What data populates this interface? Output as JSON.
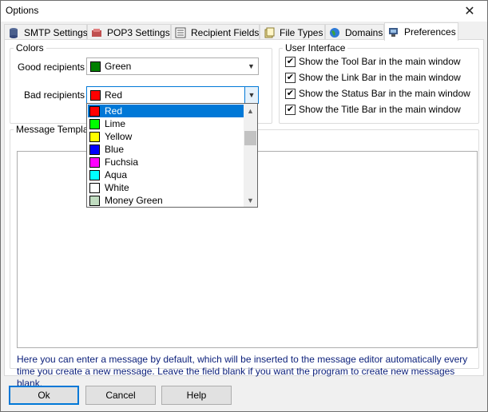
{
  "window": {
    "title": "Options",
    "close_glyph": "✕"
  },
  "tabs": [
    {
      "label": "SMTP Settings",
      "icon": "database-icon"
    },
    {
      "label": "POP3 Settings",
      "icon": "pop3-icon"
    },
    {
      "label": "Recipient Fields",
      "icon": "list-icon"
    },
    {
      "label": "File Types",
      "icon": "file-types-icon"
    },
    {
      "label": "Domains",
      "icon": "globe-icon"
    },
    {
      "label": "Preferences",
      "icon": "preferences-icon",
      "active": true
    }
  ],
  "colors_group": {
    "legend": "Colors",
    "good_label": "Good recipients :",
    "good_value": "Green",
    "good_color": "#008000",
    "bad_label": "Bad recipients :",
    "bad_value": "Red",
    "bad_color": "#ff0000"
  },
  "ui_group": {
    "legend": "User Interface",
    "options": [
      {
        "label": "Show the Tool Bar in the main window",
        "checked": true
      },
      {
        "label": "Show the Link Bar in the main window",
        "checked": true
      },
      {
        "label": "Show the Status Bar in the main window",
        "checked": true
      },
      {
        "label": "Show the Title Bar in the main window",
        "checked": true
      }
    ]
  },
  "message_group": {
    "legend": "Message Template",
    "hint": "Here you can enter a message by default, which will be inserted to the message editor automatically every time you create a new message. Leave the field blank if you want the program to create new messages blank."
  },
  "dropdown": {
    "items": [
      {
        "label": "Red",
        "color": "#ff0000",
        "selected": true
      },
      {
        "label": "Lime",
        "color": "#00ff00"
      },
      {
        "label": "Yellow",
        "color": "#ffff00"
      },
      {
        "label": "Blue",
        "color": "#0000ff"
      },
      {
        "label": "Fuchsia",
        "color": "#ff00ff"
      },
      {
        "label": "Aqua",
        "color": "#00ffff"
      },
      {
        "label": "White",
        "color": "#ffffff"
      },
      {
        "label": "Money Green",
        "color": "#c0dcc0"
      }
    ]
  },
  "buttons": {
    "ok": "Ok",
    "cancel": "Cancel",
    "help": "Help"
  }
}
